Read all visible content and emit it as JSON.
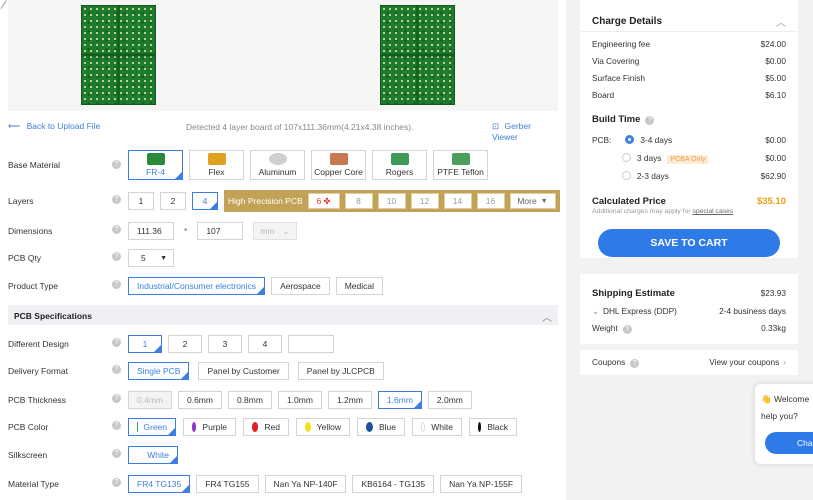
{
  "top_left": {
    "back_link": "Back to Upload File",
    "detected_text": "Detected 4 layer board of 107x111.36mm(4.21x4.38 inches).",
    "gerber_viewer": "Gerber Viewer"
  },
  "labels": {
    "base_material": "Base Material",
    "layers": "Layers",
    "dimensions": "Dimensions",
    "pcb_qty": "PCB Qty",
    "product_type": "Product Type",
    "different_design": "Different Design",
    "delivery_format": "Delivery Format",
    "pcb_thickness": "PCB Thickness",
    "pcb_color": "PCB Color",
    "silkscreen": "Silkscreen",
    "material_type": "Material Type"
  },
  "help_glyph": "?",
  "base_materials": [
    "FR-4",
    "Flex",
    "Aluminum",
    "Copper Core",
    "Rogers",
    "PTFE Teflon"
  ],
  "layers": [
    "1",
    "2",
    "4"
  ],
  "high_precision": {
    "label": "High Precision PCB",
    "options": [
      "6",
      "8",
      "10",
      "12",
      "14",
      "16"
    ],
    "more": "More"
  },
  "dimensions": {
    "width": "111.36",
    "times": "*",
    "height": "107",
    "unit": "mm"
  },
  "qty": "5",
  "product_types": [
    "Industrial/Consumer electronics",
    "Aerospace",
    "Medical"
  ],
  "section_title": "PCB Specifications",
  "different_design": [
    "1",
    "2",
    "3",
    "4",
    ""
  ],
  "delivery_formats": [
    "Single PCB",
    "Panel by Customer",
    "Panel by JLCPCB"
  ],
  "thickness": [
    "0.4mm",
    "0.6mm",
    "0.8mm",
    "1.0mm",
    "1.2mm",
    "1.6mm",
    "2.0mm"
  ],
  "colors": [
    {
      "name": "Green",
      "hex": "#2e9a4b"
    },
    {
      "name": "Purple",
      "hex": "#8e35c8"
    },
    {
      "name": "Red",
      "hex": "#e02020"
    },
    {
      "name": "Yellow",
      "hex": "#f2e21a"
    },
    {
      "name": "Blue",
      "hex": "#1f4fa3"
    },
    {
      "name": "White",
      "hex": "#ffffff"
    },
    {
      "name": "Black",
      "hex": "#111111"
    }
  ],
  "silkscreen": "White",
  "material_types": [
    "FR4 TG135",
    "FR4 TG155",
    "Nan Ya NP-140F",
    "KB6164 - TG135",
    "Nan Ya NP-155F"
  ],
  "charge": {
    "title": "Charge Details",
    "lines": [
      {
        "label": "Engineering fee",
        "value": "$24.00"
      },
      {
        "label": "Via Covering",
        "value": "$0.00"
      },
      {
        "label": "Surface Finish",
        "value": "$5.00"
      },
      {
        "label": "Board",
        "value": "$6.10"
      }
    ],
    "build_time_title": "Build Time",
    "pcb_label": "PCB:",
    "build_options": [
      {
        "label": "3-4 days",
        "value": "$0.00"
      },
      {
        "label": "3 days",
        "value": "$0.00",
        "badge": "PCBA Only"
      },
      {
        "label": "2-3 days",
        "value": "$62.90"
      }
    ],
    "calculated_label": "Calculated Price",
    "calculated_value": "$35.10",
    "note": "Additional charges may apply for",
    "note_link": "special cases",
    "cart_button": "SAVE TO CART"
  },
  "shipping": {
    "title": "Shipping Estimate",
    "total": "$23.93",
    "carrier": "DHL Express (DDP)",
    "days": "2-4 business days",
    "weight_label": "Weight",
    "weight_value": "0.33kg"
  },
  "coupons": {
    "label": "Coupons",
    "link": "View your coupons"
  },
  "chat": {
    "line1": "Welcome",
    "line2": "help you?",
    "button": "Cha"
  },
  "accent": "#3c7fe0"
}
